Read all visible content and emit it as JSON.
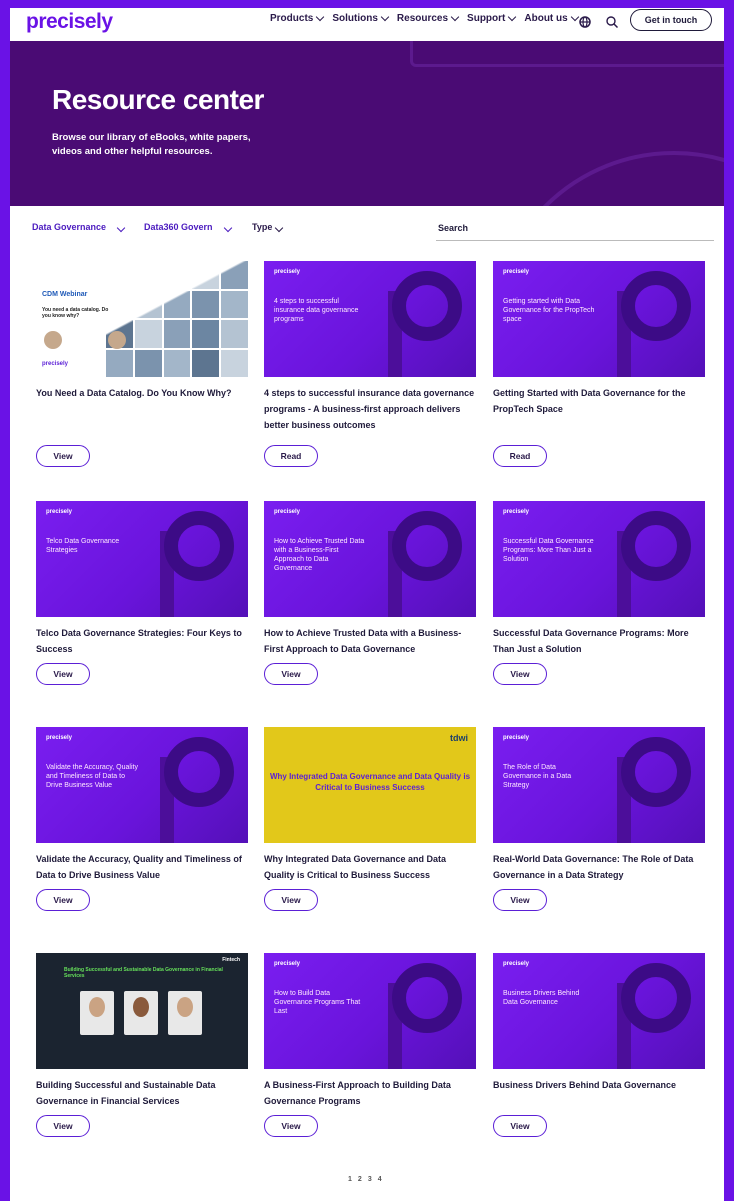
{
  "nav": {
    "logo": "precisely",
    "items": [
      "Products",
      "Solutions",
      "Resources",
      "Support",
      "About us"
    ],
    "cta": "Get in touch"
  },
  "hero": {
    "title": "Resource center",
    "subtitle": "Browse our library of eBooks, white papers, videos and other helpful resources."
  },
  "filters": {
    "topic": "Data Governance",
    "product": "Data360 Govern",
    "type": "Type",
    "search": "Search"
  },
  "cards": [
    {
      "title": "You Need a Data Catalog. Do You Know Why?",
      "button": "View",
      "thumb": {
        "kind": "collage",
        "heading": "CDM Webinar",
        "text": "You need a data catalog. Do you know why?",
        "logo": "precisely"
      }
    },
    {
      "title": "4 steps to successful insurance data governance programs - A business-first approach delivers better business outcomes",
      "button": "Read",
      "thumb": {
        "kind": "purple",
        "logo": "precisely",
        "text": "4 steps to successful insurance data governance programs"
      }
    },
    {
      "title": "Getting Started with Data Governance for the PropTech Space",
      "button": "Read",
      "thumb": {
        "kind": "purple",
        "logo": "precisely",
        "text": "Getting started with Data Governance for the PropTech space"
      }
    },
    {
      "title": "Telco Data Governance Strategies: Four Keys to Success",
      "button": "View",
      "thumb": {
        "kind": "purple",
        "logo": "precisely",
        "text": "Telco Data Governance Strategies"
      }
    },
    {
      "title": "How to Achieve Trusted Data with a Business-First Approach to Data Governance",
      "button": "View",
      "thumb": {
        "kind": "purple",
        "logo": "precisely",
        "text": "How to Achieve Trusted Data with a Business-First Approach to Data Governance"
      }
    },
    {
      "title": "Successful Data Governance Programs: More Than Just a Solution",
      "button": "View",
      "thumb": {
        "kind": "purple",
        "logo": "precisely",
        "text": "Successful Data Governance Programs: More Than Just a Solution"
      }
    },
    {
      "title": "Validate the Accuracy, Quality and Timeliness of Data to Drive Business Value",
      "button": "View",
      "thumb": {
        "kind": "purple",
        "logo": "precisely",
        "text": "Validate the Accuracy, Quality and Timeliness of Data to Drive Business Value"
      }
    },
    {
      "title": "Why Integrated Data Governance and Data Quality is Critical to Business Success",
      "button": "View",
      "thumb": {
        "kind": "yellow",
        "logo": "tdwi",
        "text": "Why Integrated Data Governance and Data Quality is Critical to Business Success"
      }
    },
    {
      "title": "Real-World Data Governance: The Role of Data Governance in a Data Strategy",
      "button": "View",
      "thumb": {
        "kind": "purple",
        "logo": "precisely",
        "text": "The Role of Data Governance in a Data Strategy"
      }
    },
    {
      "title": "Building Successful and Sustainable Data Governance in Financial Services",
      "button": "View",
      "thumb": {
        "kind": "dark",
        "logo": "Fintech",
        "text": "Building Successful and Sustainable Data Governance in Financial Services"
      }
    },
    {
      "title": "A Business-First Approach to Building Data Governance Programs",
      "button": "View",
      "thumb": {
        "kind": "purple",
        "logo": "precisely",
        "text": "How to Build Data Governance Programs That Last"
      }
    },
    {
      "title": "Business Drivers Behind Data Governance",
      "button": "View",
      "thumb": {
        "kind": "purple",
        "logo": "precisely",
        "text": "Business Drivers Behind Data Governance"
      }
    }
  ],
  "pagination": [
    "1",
    "2",
    "3",
    "4"
  ],
  "colors": {
    "brand": "#6a12e6",
    "hero": "#4a0b74",
    "text": "#1f1a3a"
  }
}
